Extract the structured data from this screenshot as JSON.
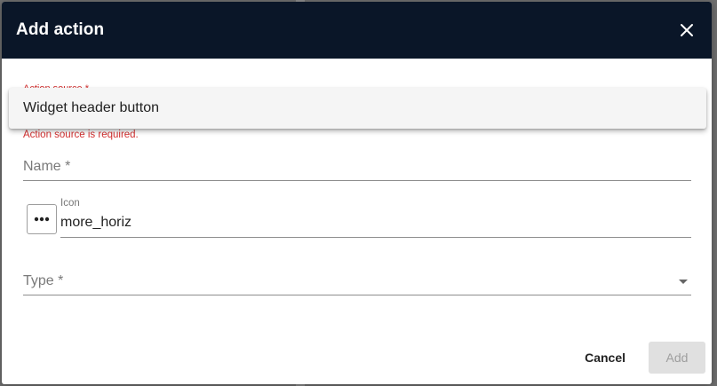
{
  "dialog": {
    "title": "Add action",
    "close_icon": "close-icon"
  },
  "action_source": {
    "label": "Action source *",
    "selected_option": "Widget header button",
    "error": "Action source is required."
  },
  "name_field": {
    "placeholder": "Name *"
  },
  "icon_field": {
    "label": "Icon",
    "value": "more_horiz",
    "picker_icon": "more-horiz-icon"
  },
  "type_field": {
    "placeholder": "Type *"
  },
  "buttons": {
    "cancel": "Cancel",
    "add": "Add"
  },
  "colors": {
    "titlebar": "#0a1628",
    "error": "#d32f2f"
  }
}
